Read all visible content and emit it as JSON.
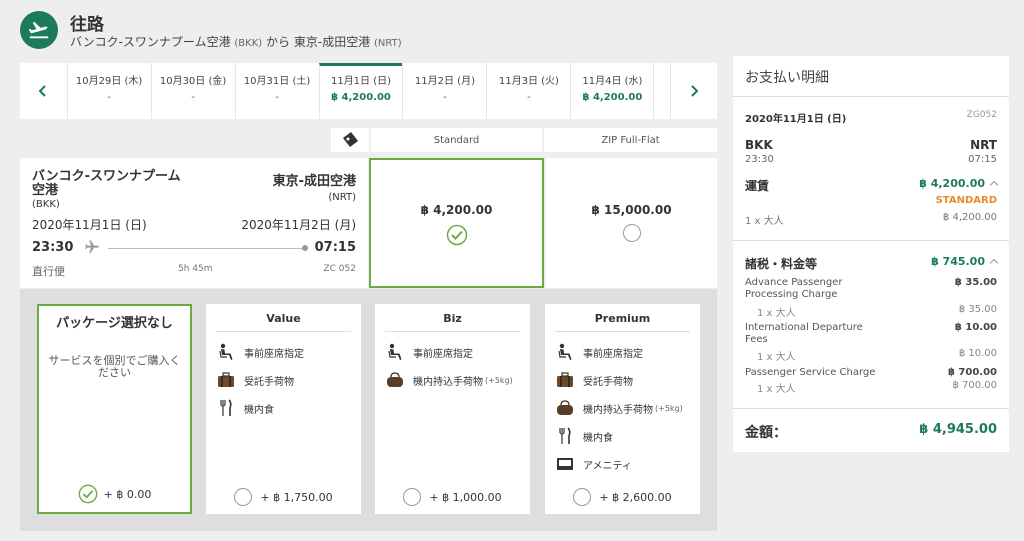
{
  "header": {
    "title": "往路",
    "route_text": "バンコク-スワンナプーム空港",
    "origin_code": "(BKK)",
    "connector": "から",
    "dest_text": "東京-成田空港",
    "dest_code": "(NRT)"
  },
  "date_bar": {
    "days": [
      {
        "label": "10月29日 (木)",
        "price": "-"
      },
      {
        "label": "10月30日 (金)",
        "price": "-"
      },
      {
        "label": "10月31日 (土)",
        "price": "-"
      },
      {
        "label": "11月1日 (日)",
        "price": "฿ 4,200.00"
      },
      {
        "label": "11月2日 (月)",
        "price": "-"
      },
      {
        "label": "11月3日 (火)",
        "price": "-"
      },
      {
        "label": "11月4日 (水)",
        "price": "฿ 4,200.00"
      }
    ]
  },
  "fare_headers": {
    "standard": "Standard",
    "zip_full_flat": "ZIP Full-Flat"
  },
  "flight": {
    "dep_name_line1": "バンコク-スワンナプーム",
    "dep_name_line2": "空港",
    "dep_code": "(BKK)",
    "arr_name": "東京-成田空港",
    "arr_code": "(NRT)",
    "dep_date": "2020年11月1日 (日)",
    "arr_date": "2020年11月2日 (月)",
    "dep_time": "23:30",
    "arr_time": "07:15",
    "type": "直行便",
    "duration": "5h 45m",
    "flight_no": "ZC 052"
  },
  "fares": {
    "standard_price": "฿ 4,200.00",
    "zip_price": "฿ 15,000.00"
  },
  "packages": {
    "none": {
      "name": "パッケージ選択なし",
      "desc": "サービスを個別でご購入ください",
      "price": "+ ฿ 0.00"
    },
    "value": {
      "name": "Value",
      "f1": "事前座席指定",
      "f2": "受託手荷物",
      "f3": "機内食",
      "price": "+ ฿ 1,750.00"
    },
    "biz": {
      "name": "Biz",
      "f1": "事前座席指定",
      "f2": "機内持込手荷物",
      "f2_note": "(+5kg)",
      "price": "+ ฿ 1,000.00"
    },
    "premium": {
      "name": "Premium",
      "f1": "事前座席指定",
      "f2": "受託手荷物",
      "f3": "機内持込手荷物",
      "f3_note": "(+5kg)",
      "f4": "機内食",
      "f5": "アメニティ",
      "price": "+ ฿ 2,600.00"
    }
  },
  "summary": {
    "title": "お支払い明細",
    "date": "2020年11月1日 (日)",
    "flight_no": "ZG052",
    "from": "BKK",
    "to": "NRT",
    "dep_time": "23:30",
    "arr_time": "07:15",
    "fare_label": "運賃",
    "fare_total": "฿ 4,200.00",
    "fare_class": "STANDARD",
    "pax": "1 x 大人",
    "fare_each": "฿ 4,200.00",
    "tax_label": "諸税・料金等",
    "tax_total": "฿ 745.00",
    "tax1_name_l1": "Advance Passenger",
    "tax1_name_l2": "Processing Charge",
    "tax1_price": "฿ 35.00",
    "tax1_pax": "1 x 大人",
    "tax1_each": "฿ 35.00",
    "tax2_name_l1": "International Departure",
    "tax2_name_l2": "Fees",
    "tax2_price": "฿ 10.00",
    "tax2_pax": "1 x 大人",
    "tax2_each": "฿ 10.00",
    "tax3_name": "Passenger Service Charge",
    "tax3_price": "฿ 700.00",
    "tax3_pax": "1 x 大人",
    "tax3_each": "฿ 700.00",
    "total_label": "金額：",
    "total": "฿ 4,945.00"
  },
  "colors": {
    "brand": "#1d7a5b",
    "select": "#6aab45",
    "accent": "#e8892c"
  }
}
